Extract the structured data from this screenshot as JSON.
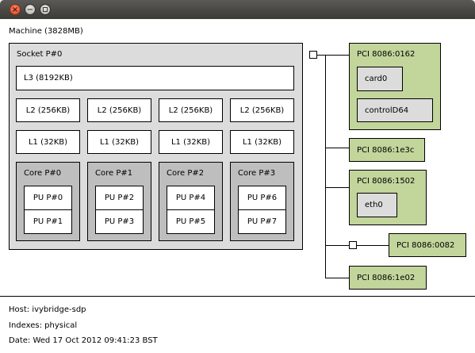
{
  "window": {
    "close_glyph": "×",
    "min_glyph": "−"
  },
  "machine": {
    "label": "Machine (3828MB)",
    "socket": {
      "label": "Socket P#0",
      "l3": "L3 (8192KB)",
      "l2": [
        "L2 (256KB)",
        "L2 (256KB)",
        "L2 (256KB)",
        "L2 (256KB)"
      ],
      "l1": [
        "L1 (32KB)",
        "L1 (32KB)",
        "L1 (32KB)",
        "L1 (32KB)"
      ],
      "cores": [
        {
          "label": "Core P#0",
          "pus": [
            "PU P#0",
            "PU P#1"
          ]
        },
        {
          "label": "Core P#1",
          "pus": [
            "PU P#2",
            "PU P#3"
          ]
        },
        {
          "label": "Core P#2",
          "pus": [
            "PU P#4",
            "PU P#5"
          ]
        },
        {
          "label": "Core P#3",
          "pus": [
            "PU P#6",
            "PU P#7"
          ]
        }
      ]
    }
  },
  "pci": [
    {
      "label": "PCI 8086:0162",
      "devices": [
        "card0",
        "controlD64"
      ]
    },
    {
      "label": "PCI 8086:1e3c",
      "devices": []
    },
    {
      "label": "PCI 8086:1502",
      "devices": [
        "eth0"
      ]
    },
    {
      "label": "PCI 8086:0082",
      "devices": []
    },
    {
      "label": "PCI 8086:1e02",
      "devices": []
    }
  ],
  "footer": {
    "host": "Host: ivybridge-sdp",
    "indexes": "Indexes: physical",
    "date": "Date: Wed 17 Oct 2012 09:41:23 BST"
  }
}
